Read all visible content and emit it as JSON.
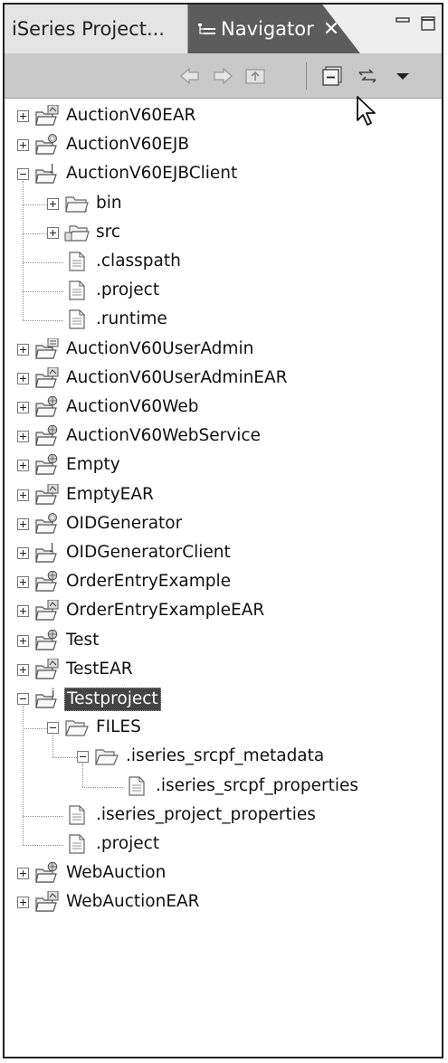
{
  "tabs": {
    "inactive_label": "iSeries Project...",
    "active_label": "Navigator",
    "close_glyph": "✕"
  },
  "toolbar": {
    "back": "back-arrow-icon",
    "forward": "forward-arrow-icon",
    "up": "up-folder-icon",
    "collapse_all": "collapse-all-icon",
    "link_editor": "link-with-editor-icon",
    "menu": "view-menu-icon"
  },
  "tree": {
    "items": [
      {
        "label": "AuctionV60EAR",
        "depth": 0,
        "type": "project",
        "overlay": "ear",
        "expander": "plus"
      },
      {
        "label": "AuctionV60EJB",
        "depth": 0,
        "type": "project",
        "overlay": "ejb",
        "expander": "plus"
      },
      {
        "label": "AuctionV60EJBClient",
        "depth": 0,
        "type": "project",
        "overlay": "java",
        "expander": "minus"
      },
      {
        "label": "bin",
        "depth": 1,
        "type": "folder",
        "expander": "plus"
      },
      {
        "label": "src",
        "depth": 1,
        "type": "package-folder",
        "expander": "plus"
      },
      {
        "label": ".classpath",
        "depth": 1,
        "type": "file",
        "expander": "none"
      },
      {
        "label": ".project",
        "depth": 1,
        "type": "file",
        "expander": "none"
      },
      {
        "label": ".runtime",
        "depth": 1,
        "type": "file",
        "expander": "none"
      },
      {
        "label": "AuctionV60UserAdmin",
        "depth": 0,
        "type": "project",
        "overlay": "app",
        "expander": "plus"
      },
      {
        "label": "AuctionV60UserAdminEAR",
        "depth": 0,
        "type": "project",
        "overlay": "ear",
        "expander": "plus"
      },
      {
        "label": "AuctionV60Web",
        "depth": 0,
        "type": "project",
        "overlay": "web",
        "expander": "plus"
      },
      {
        "label": "AuctionV60WebService",
        "depth": 0,
        "type": "project",
        "overlay": "web",
        "expander": "plus"
      },
      {
        "label": "Empty",
        "depth": 0,
        "type": "project",
        "overlay": "web",
        "expander": "plus"
      },
      {
        "label": "EmptyEAR",
        "depth": 0,
        "type": "project",
        "overlay": "ear",
        "expander": "plus"
      },
      {
        "label": "OIDGenerator",
        "depth": 0,
        "type": "project",
        "overlay": "ejb",
        "expander": "plus"
      },
      {
        "label": "OIDGeneratorClient",
        "depth": 0,
        "type": "project",
        "overlay": "java",
        "expander": "plus"
      },
      {
        "label": "OrderEntryExample",
        "depth": 0,
        "type": "project",
        "overlay": "web",
        "expander": "plus"
      },
      {
        "label": "OrderEntryExampleEAR",
        "depth": 0,
        "type": "project",
        "overlay": "ear",
        "expander": "plus"
      },
      {
        "label": "Test",
        "depth": 0,
        "type": "project",
        "overlay": "web",
        "expander": "plus"
      },
      {
        "label": "TestEAR",
        "depth": 0,
        "type": "project",
        "overlay": "ear",
        "expander": "plus"
      },
      {
        "label": "Testproject",
        "depth": 0,
        "type": "project",
        "overlay": "iseries",
        "expander": "minus",
        "selected": true
      },
      {
        "label": "FILES",
        "depth": 1,
        "type": "folder-open",
        "expander": "minus"
      },
      {
        "label": ".iseries_srcpf_metadata",
        "depth": 2,
        "type": "folder-open",
        "expander": "minus"
      },
      {
        "label": ".iseries_srcpf_properties",
        "depth": 3,
        "type": "file",
        "expander": "none"
      },
      {
        "label": ".iseries_project_properties",
        "depth": 1,
        "type": "file",
        "expander": "none"
      },
      {
        "label": ".project",
        "depth": 1,
        "type": "file",
        "expander": "none"
      },
      {
        "label": "WebAuction",
        "depth": 0,
        "type": "project",
        "overlay": "web",
        "expander": "plus"
      },
      {
        "label": "WebAuctionEAR",
        "depth": 0,
        "type": "project",
        "overlay": "ear",
        "expander": "plus"
      }
    ]
  }
}
